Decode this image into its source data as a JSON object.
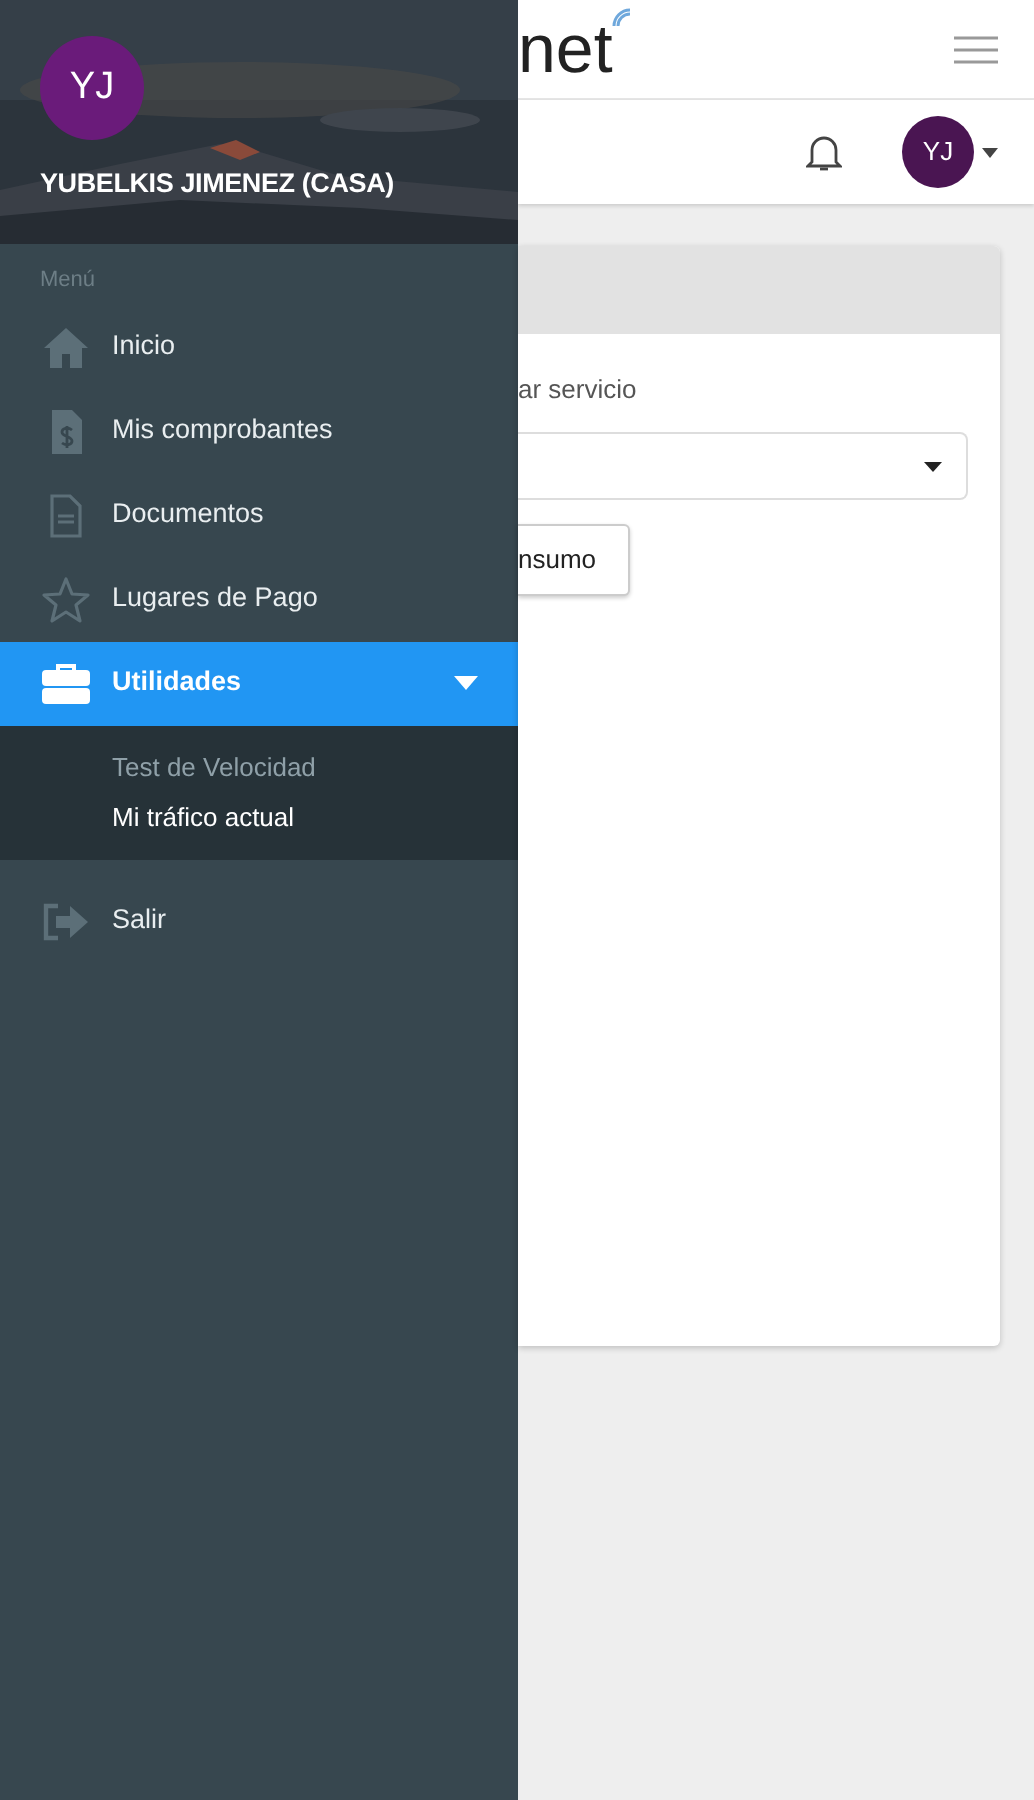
{
  "drawer": {
    "user": {
      "initials": "YJ",
      "name": "YUBELKIS JIMENEZ (CASA)"
    },
    "section_label": "Menú",
    "items": [
      {
        "label": "Inicio",
        "kind": "home",
        "selected": false
      },
      {
        "label": "Mis comprobantes",
        "kind": "receipt",
        "selected": false
      },
      {
        "label": "Documentos",
        "kind": "document",
        "selected": false
      },
      {
        "label": "Lugares de Pago",
        "kind": "star",
        "selected": false
      },
      {
        "label": "Utilidades",
        "kind": "toolbox",
        "selected": true,
        "expanded": true,
        "children": [
          {
            "label": "Test de Velocidad",
            "selected": false
          },
          {
            "label": "Mi tráfico actual",
            "selected": true
          }
        ]
      },
      {
        "label": "Salir",
        "kind": "exit",
        "selected": false
      }
    ]
  },
  "topbar": {
    "logo_text": "net"
  },
  "userbar": {
    "avatar_initials": "YJ"
  },
  "card": {
    "field_label": "ar servicio",
    "button": "nsumo"
  }
}
